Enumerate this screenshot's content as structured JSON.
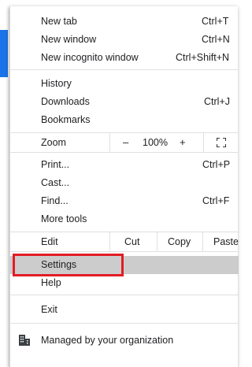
{
  "menu": {
    "new_tab": {
      "label": "New tab",
      "shortcut": "Ctrl+T"
    },
    "new_window": {
      "label": "New window",
      "shortcut": "Ctrl+N"
    },
    "new_incognito": {
      "label": "New incognito window",
      "shortcut": "Ctrl+Shift+N"
    },
    "history": {
      "label": "History"
    },
    "downloads": {
      "label": "Downloads",
      "shortcut": "Ctrl+J"
    },
    "bookmarks": {
      "label": "Bookmarks"
    },
    "zoom": {
      "label": "Zoom",
      "minus": "–",
      "value": "100%",
      "plus": "+"
    },
    "print": {
      "label": "Print...",
      "shortcut": "Ctrl+P"
    },
    "cast": {
      "label": "Cast..."
    },
    "find": {
      "label": "Find...",
      "shortcut": "Ctrl+F"
    },
    "more_tools": {
      "label": "More tools"
    },
    "edit": {
      "label": "Edit",
      "cut": "Cut",
      "copy": "Copy",
      "paste": "Paste"
    },
    "settings": {
      "label": "Settings"
    },
    "help": {
      "label": "Help"
    },
    "exit": {
      "label": "Exit"
    },
    "managed": {
      "label": "Managed by your organization"
    }
  },
  "colors": {
    "highlight": "#e21d24",
    "hover_bg": "#cccccc",
    "accent": "#1a73e8"
  }
}
